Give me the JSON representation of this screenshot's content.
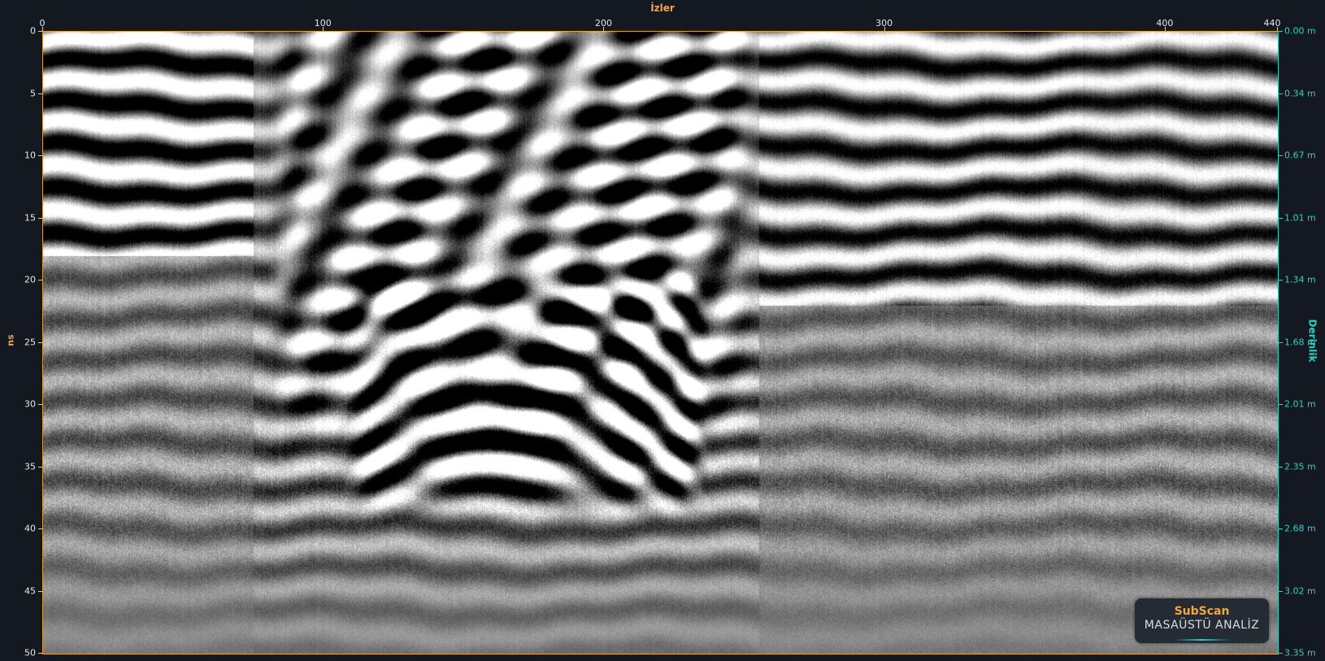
{
  "window": {
    "x_axis_title": "İzler",
    "y_axis_title": "ns",
    "depth_axis_title": "Derinlik"
  },
  "x_axis": {
    "ticks": [
      "0",
      "100",
      "200",
      "300",
      "400",
      "440"
    ],
    "tick_values": [
      0,
      100,
      200,
      300,
      400,
      440
    ],
    "range": [
      0,
      440
    ]
  },
  "y_axis": {
    "ticks": [
      "0",
      "5",
      "10",
      "15",
      "20",
      "25",
      "30",
      "35",
      "40",
      "45",
      "50"
    ],
    "tick_values": [
      0,
      5,
      10,
      15,
      20,
      25,
      30,
      35,
      40,
      45,
      50
    ],
    "range": [
      0,
      50
    ]
  },
  "depth_axis": {
    "ticks": [
      "0.00 m",
      "0.34 m",
      "0.67 m",
      "1.01 m",
      "1.34 m",
      "1.68 m",
      "2.01 m",
      "2.35 m",
      "2.68 m",
      "3.02 m",
      "3.35 m"
    ],
    "tick_values_ns": [
      0,
      5,
      10,
      15,
      20,
      25,
      30,
      35,
      40,
      45,
      50
    ]
  },
  "logo": {
    "title": "SubScan",
    "subtitle": "MASAÜSTÜ ANALİZ"
  },
  "colors": {
    "background": "#141821",
    "x_axis_color": "#f0a640",
    "depth_axis_color": "#27d3c3",
    "plot_border": "#e3a23c"
  }
}
